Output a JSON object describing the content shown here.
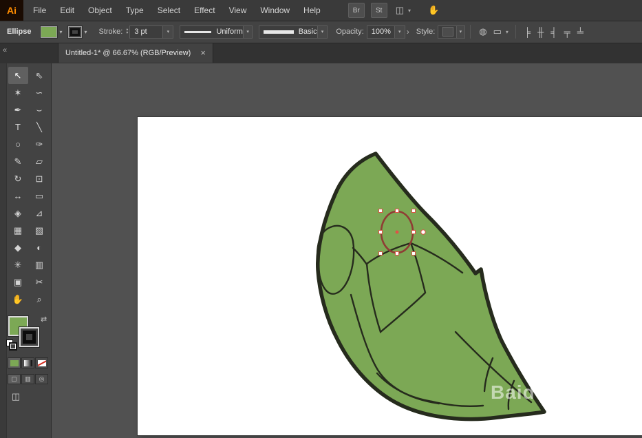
{
  "app": {
    "logo_text": "Ai",
    "menus": [
      {
        "name": "menu-file",
        "label": "File"
      },
      {
        "name": "menu-edit",
        "label": "Edit"
      },
      {
        "name": "menu-object",
        "label": "Object"
      },
      {
        "name": "menu-type",
        "label": "Type"
      },
      {
        "name": "menu-select",
        "label": "Select"
      },
      {
        "name": "menu-effect",
        "label": "Effect"
      },
      {
        "name": "menu-view",
        "label": "View"
      },
      {
        "name": "menu-window",
        "label": "Window"
      },
      {
        "name": "menu-help",
        "label": "Help"
      }
    ],
    "bridge_button_label": "Br",
    "stock_button_label": "St"
  },
  "glyphs": {
    "dropdown": "▾",
    "stepper_up": "▴",
    "stepper_down": "▾",
    "flyout": "›",
    "close": "×",
    "collapse": "«",
    "swap_fill_stroke": "⇄",
    "workspace_switcher": "◫",
    "touch_workspace": "✋",
    "recolor_artwork": "◍",
    "transform_panel": "▭",
    "screen_mode": "◫"
  },
  "control_bar": {
    "tool_name": "Ellipse",
    "stroke_label": "Stroke:",
    "stroke_weight": "3 pt",
    "variable_width_profile": "Uniform",
    "brush_definition": "Basic",
    "opacity_label": "Opacity:",
    "opacity_value": "100%",
    "style_label": "Style:",
    "align_icons": [
      {
        "name": "align-horizontal-left-icon",
        "glyph": "╞"
      },
      {
        "name": "align-horizontal-center-icon",
        "glyph": "╫"
      },
      {
        "name": "align-horizontal-right-icon",
        "glyph": "╡"
      },
      {
        "name": "align-vertical-top-icon",
        "glyph": "╤"
      },
      {
        "name": "align-vertical-bottom-icon",
        "glyph": "╧"
      }
    ]
  },
  "tab_bar": {
    "document_title": "Untitled-1* @ 66.67% (RGB/Preview)"
  },
  "toolbox": {
    "tools": [
      {
        "name": "selection-tool",
        "glyph": "↖",
        "selected": true
      },
      {
        "name": "direct-selection-tool",
        "glyph": "⇖"
      },
      {
        "name": "magic-wand-tool",
        "glyph": "✶"
      },
      {
        "name": "lasso-tool",
        "glyph": "∽"
      },
      {
        "name": "pen-tool",
        "glyph": "✒"
      },
      {
        "name": "curvature-tool",
        "glyph": "⌣"
      },
      {
        "name": "type-tool",
        "glyph": "T"
      },
      {
        "name": "line-segment-tool",
        "glyph": "╲"
      },
      {
        "name": "ellipse-tool",
        "glyph": "○"
      },
      {
        "name": "paintbrush-tool",
        "glyph": "✑"
      },
      {
        "name": "shaper-tool",
        "glyph": "✎"
      },
      {
        "name": "eraser-tool",
        "glyph": "▱"
      },
      {
        "name": "rotate-tool",
        "glyph": "↻"
      },
      {
        "name": "scale-tool",
        "glyph": "⊡"
      },
      {
        "name": "width-tool",
        "glyph": "↔"
      },
      {
        "name": "free-transform-tool",
        "glyph": "▭"
      },
      {
        "name": "shape-builder-tool",
        "glyph": "◈"
      },
      {
        "name": "perspective-grid-tool",
        "glyph": "⊿"
      },
      {
        "name": "mesh-tool",
        "glyph": "▦"
      },
      {
        "name": "gradient-tool",
        "glyph": "▧"
      },
      {
        "name": "eyedropper-tool",
        "glyph": "◆"
      },
      {
        "name": "blend-tool",
        "glyph": "◐"
      },
      {
        "name": "symbol-sprayer-tool",
        "glyph": "✳"
      },
      {
        "name": "column-graph-tool",
        "glyph": "▥"
      },
      {
        "name": "artboard-tool",
        "glyph": "▣"
      },
      {
        "name": "slice-tool",
        "glyph": "✂"
      },
      {
        "name": "hand-tool",
        "glyph": "✋"
      },
      {
        "name": "zoom-tool",
        "glyph": "⌕"
      }
    ],
    "draw_modes": [
      {
        "name": "draw-normal-mode-button",
        "glyph": "▢",
        "selected": true
      },
      {
        "name": "draw-behind-mode-button",
        "glyph": "▥"
      },
      {
        "name": "draw-inside-mode-button",
        "glyph": "◎"
      }
    ]
  },
  "document": {
    "watermark": "Baidu"
  },
  "colors": {
    "artwork_fill": "#7CA855",
    "artwork_outline": "#262b1d",
    "selection_accent": "#E05247",
    "ellipse_stroke": "#8F3C34"
  }
}
